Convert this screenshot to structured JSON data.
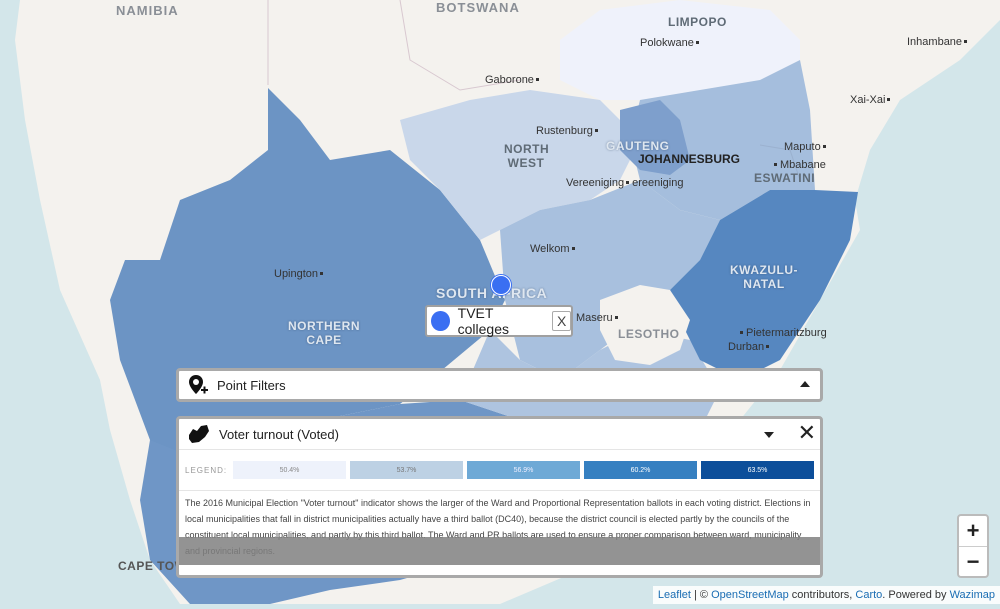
{
  "map": {
    "countries": [
      "NAMIBIA",
      "BOTSWANA",
      "ESWATINI",
      "LESOTHO",
      "SOUTH AFRICA"
    ],
    "regions": [
      "LIMPOPO",
      "NORTH WEST",
      "GAUTENG",
      "JOHANNESBURG",
      "KWAZULU-NATAL",
      "NORTHERN CAPE",
      "CAPE TOWN"
    ],
    "cities": [
      "Polokwane",
      "Inhambane",
      "Gaborone",
      "Xai-Xai",
      "Rustenburg",
      "Maputo",
      "Mbabane",
      "Vereeniging",
      "Vereeniging",
      "Welkom",
      "Upington",
      "Maseru",
      "Pietermaritzburg",
      "Durban"
    ]
  },
  "labels": {
    "namibia": "NAMIBIA",
    "botswana": "BOTSWANA",
    "limpopo": "LIMPOPO",
    "polokwane": "Polokwane",
    "inhambane": "Inhambane",
    "gaborone": "Gaborone",
    "xaixai": "Xai-Xai",
    "rustenburg": "Rustenburg",
    "north_west_1": "NORTH",
    "north_west_2": "WEST",
    "gauteng": "GAUTENG",
    "johannesburg": "JOHANNESBURG",
    "maputo": "Maputo",
    "mbabane": "Mbabane",
    "eswatini": "ESWATINI",
    "vereeniging1": "Vereeniging",
    "vereeniging2": "ereeniging",
    "welkom": "Welkom",
    "upington": "Upington",
    "kzn_1": "KWAZULU-",
    "kzn_2": "NATAL",
    "south_africa": "SOUTH AFRICA",
    "maseru": "Maseru",
    "lesotho": "LESOTHO",
    "pietermaritzburg": "Pietermaritzburg",
    "durban": "Durban",
    "ncape_1": "NORTHERN",
    "ncape_2": "CAPE",
    "cape_town": "CAPE TOWN"
  },
  "point_chip": {
    "label": "TVET colleges",
    "close": "X",
    "color": "#3a6ff2"
  },
  "point_filters": {
    "title": "Point Filters",
    "icon": "map-pin-plus-icon"
  },
  "voter_panel": {
    "title": "Voter turnout (Voted)",
    "icon": "south-africa-map-icon",
    "close": "✕",
    "legend_title": "LEGEND:",
    "legend": [
      {
        "label": "50.4%",
        "color": "#eef2fb",
        "text_color": "#888"
      },
      {
        "label": "53.7%",
        "color": "#bdd1e4",
        "text_color": "#777"
      },
      {
        "label": "56.9%",
        "color": "#6ea9d6",
        "text_color": "#eef"
      },
      {
        "label": "60.2%",
        "color": "#3680c1",
        "text_color": "#fff"
      },
      {
        "label": "63.5%",
        "color": "#0c4e9a",
        "text_color": "#fff"
      }
    ],
    "description": "The 2016 Municipal Election \"Voter turnout\" indicator shows the larger of the Ward and Proportional Representation ballots in each voting district. Elections in local municipalities that fall in district municipalities actually have a third ballot (DC40), because the district council is elected partly by the councils of the constituent local municipalities, and partly by this third ballot. The Ward and PR ballots are used to ensure a proper comparison between ward, municipality and provincial regions."
  },
  "zoom": {
    "in": "+",
    "out": "−"
  },
  "attribution": {
    "leaflet": "Leaflet",
    "sep": " | © ",
    "osm": "OpenStreetMap",
    "contrib": " contributors, ",
    "carto": "Carto",
    "powered": ". Powered by ",
    "wazimap": "Wazimap"
  }
}
